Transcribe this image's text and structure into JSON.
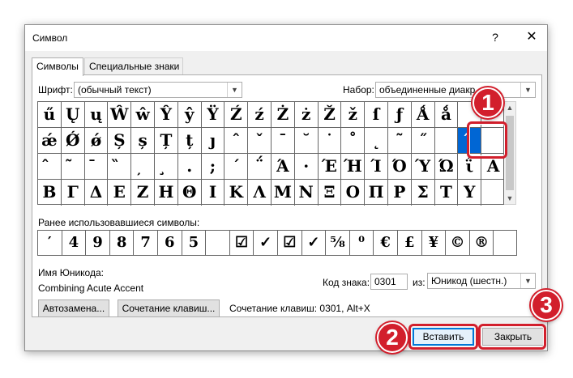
{
  "window": {
    "title": "Символ",
    "help_label": "?",
    "close_label": "✕"
  },
  "tabs": [
    {
      "label": "Символы"
    },
    {
      "label": "Специальные знаки"
    }
  ],
  "font": {
    "label": "Шрифт:",
    "value": "(обычный текст)"
  },
  "subset": {
    "label": "Набор:",
    "value": "объединенные диакр."
  },
  "symbol_rows": [
    [
      "ű",
      "Ų",
      "ų",
      "Ŵ",
      "ŵ",
      "Ŷ",
      "ŷ",
      "Ÿ",
      "Ź",
      "ź",
      "Ż",
      "ż",
      "Ž",
      "ž",
      "ſ",
      "ƒ",
      "Ǻ",
      "ǻ",
      "",
      ""
    ],
    [
      "ǽ",
      "Ǿ",
      "ǿ",
      "Ș",
      "ș",
      "Ț",
      "ț",
      "ȷ",
      "ˆ",
      "ˇ",
      "ˉ",
      "˘",
      "˙",
      "˚",
      "˛",
      "˜",
      "˝",
      "",
      "́",
      ""
    ],
    [
      "̂",
      "̃",
      "̄",
      "̏",
      "̦",
      "̧",
      ".",
      ";",
      "΄",
      "΅",
      "Ά",
      "·",
      "Έ",
      "Ή",
      "Ί",
      "Ό",
      "Ύ",
      "Ώ",
      "ΐ",
      "Α"
    ],
    [
      "Β",
      "Γ",
      "Δ",
      "Ε",
      "Ζ",
      "Η",
      "Θ",
      "Ι",
      "Κ",
      "Λ",
      "Μ",
      "Ν",
      "Ξ",
      "Ο",
      "Π",
      "Ρ",
      "Σ",
      "Τ",
      "Υ",
      ""
    ]
  ],
  "selected_cell": {
    "row": 1,
    "col": 18
  },
  "recent": {
    "label": "Ранее использовавшиеся символы:",
    "items": [
      "′",
      "4",
      "9",
      "8",
      "7",
      "6",
      "5",
      "",
      "☑",
      "✓",
      "☑",
      "✓",
      "⅝",
      "⁰",
      "€",
      "£",
      "¥",
      "©",
      "®",
      ""
    ]
  },
  "unicode_name": {
    "label": "Имя Юникода:",
    "value": "Combining Acute Accent"
  },
  "char_code": {
    "label": "Код знака:",
    "value": "0301"
  },
  "from": {
    "label": "из:",
    "value": "Юникод (шестн.)"
  },
  "buttons": {
    "autocorrect": "Автозамена...",
    "shortcut_key": "Сочетание клавиш...",
    "insert": "Вставить",
    "close": "Закрыть"
  },
  "shortcut_text": "Сочетание клавиш: 0301, Alt+X",
  "callouts": [
    "1",
    "2",
    "3"
  ],
  "colors": {
    "accent": "#d21f2c",
    "selection": "#0066d4",
    "default_button": "#0078d7"
  }
}
